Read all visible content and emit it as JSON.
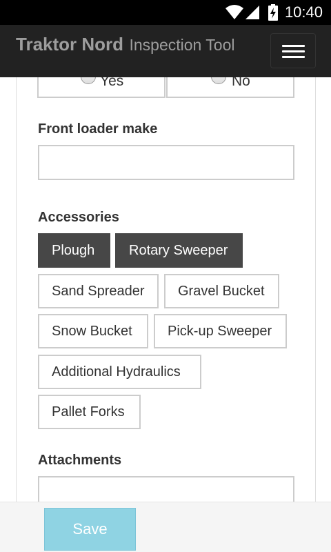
{
  "status_bar": {
    "time": "10:40",
    "icons": [
      "wifi-icon",
      "signal-icon",
      "battery-charging-icon"
    ]
  },
  "navbar": {
    "brand_name": "Traktor Nord",
    "brand_subtitle": "Inspection Tool",
    "menu_icon": "hamburger-menu-icon"
  },
  "form": {
    "yes_no": {
      "yes_label": "Yes",
      "no_label": "No"
    },
    "front_loader_make": {
      "label": "Front loader make",
      "value": ""
    },
    "accessories": {
      "label": "Accessories",
      "options": [
        {
          "label": "Plough",
          "selected": true
        },
        {
          "label": "Rotary Sweeper",
          "selected": true
        },
        {
          "label": "Sand Spreader",
          "selected": false
        },
        {
          "label": "Gravel Bucket",
          "selected": false
        },
        {
          "label": "Snow Bucket",
          "selected": false
        },
        {
          "label": "Pick-up Sweeper",
          "selected": false
        },
        {
          "label": "Additional Hydraulics",
          "selected": false
        },
        {
          "label": "Pallet Forks",
          "selected": false
        }
      ]
    },
    "attachments": {
      "label": "Attachments",
      "value": ""
    }
  },
  "footer": {
    "save_label": "Save"
  },
  "colors": {
    "navbar_bg": "#222222",
    "chip_selected_bg": "#474747",
    "save_button_bg": "#8fd3e3"
  }
}
